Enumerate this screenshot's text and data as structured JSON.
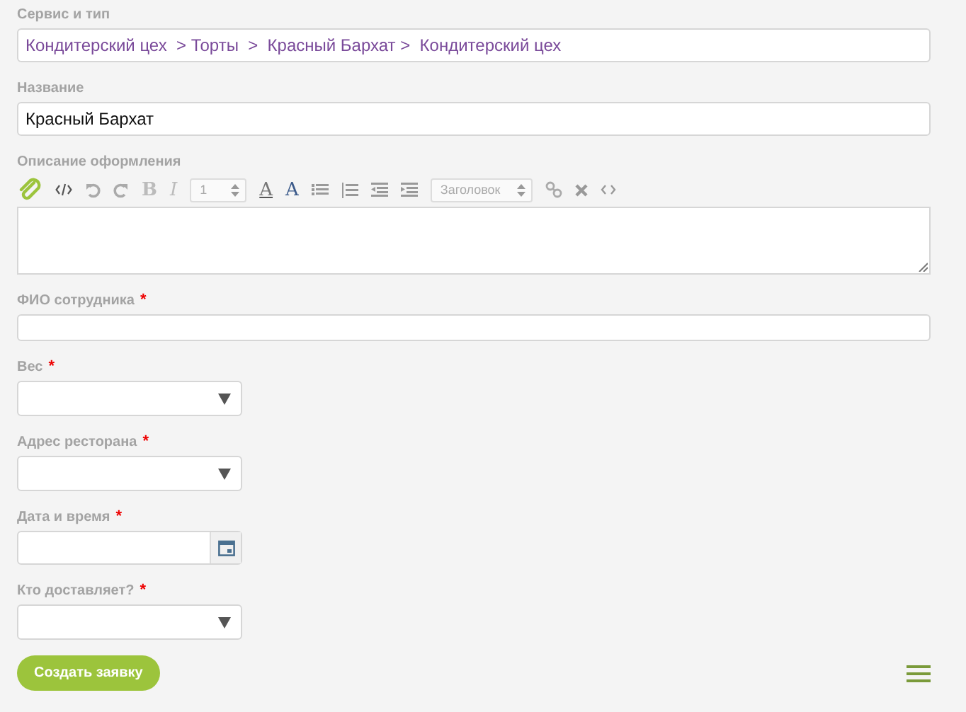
{
  "fields": [
    {
      "kind": "text",
      "label": "Сервис и тип",
      "required": false,
      "value": "Кондитерский цех  > Торты  >  Красный Бархат >  Кондитерский цех"
    },
    {
      "kind": "text",
      "label": "Название",
      "required": false,
      "value": "Красный Бархат"
    },
    {
      "kind": "editor",
      "label": "Описание оформления",
      "required": false,
      "toolbar": [
        {
          "kind": "attach"
        },
        {
          "kind": "code"
        },
        {
          "kind": "undo"
        },
        {
          "kind": "redo"
        },
        {
          "kind": "glyph",
          "text": "B"
        },
        {
          "kind": "glyph",
          "text": "I"
        },
        {
          "kind": "select",
          "text": "1"
        },
        {
          "kind": "glyph",
          "text": "A"
        },
        {
          "kind": "glyph",
          "text": "A"
        },
        {
          "kind": "bullets"
        },
        {
          "kind": "numbers"
        },
        {
          "kind": "outdent"
        },
        {
          "kind": "indent"
        },
        {
          "kind": "select",
          "text": "Заголовок"
        },
        {
          "kind": "link"
        },
        {
          "kind": "clear"
        },
        {
          "kind": "source"
        }
      ]
    },
    {
      "kind": "short",
      "label": "ФИО сотрудника",
      "required": true
    },
    {
      "kind": "select",
      "label": "Вес",
      "required": true
    },
    {
      "kind": "select",
      "label": "Адрес ресторана",
      "required": true
    },
    {
      "kind": "date",
      "label": "Дата и время",
      "required": true
    },
    {
      "kind": "select",
      "label": "Кто доставляет?",
      "required": true
    }
  ],
  "star": "*",
  "submit": "Создать заявку"
}
